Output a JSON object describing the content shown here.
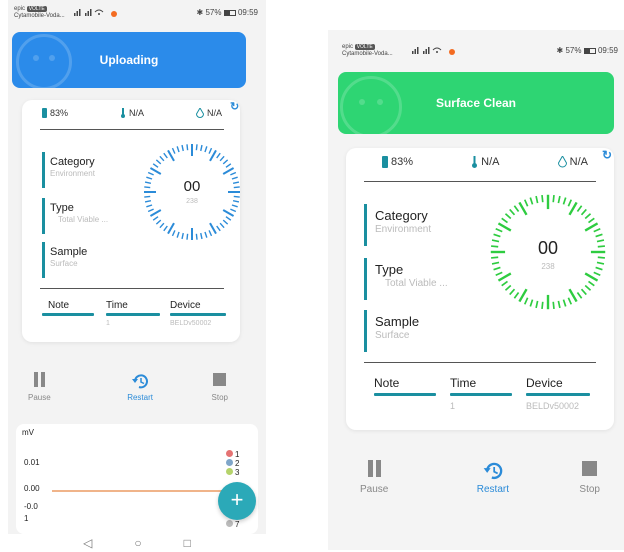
{
  "statusbar": {
    "carrier_tag": "epic",
    "carrier_badge": "VOLTE",
    "carrier_name": "Cytamobile-Voda...",
    "signal_icons": "signal-icon",
    "bluetooth": "✱",
    "battery_pct": "57%",
    "time": "09:59"
  },
  "left": {
    "banner_title": "Uploading",
    "banner_color": "#2b8bea",
    "stats": {
      "battery": "83%",
      "temp": "N/A",
      "humidity": "N/A"
    },
    "fields": [
      {
        "label": "Category",
        "value": "Environment"
      },
      {
        "label": "Type",
        "value": "Total Viable ..."
      },
      {
        "label": "Sample",
        "value": "Surface"
      }
    ],
    "gauge": {
      "main": "00",
      "sub": "238"
    },
    "columns": [
      {
        "header": "Note",
        "value": ""
      },
      {
        "header": "Time",
        "value": "1"
      },
      {
        "header": "Device",
        "value": "BELDv50002"
      }
    ],
    "controls": {
      "pause": "Pause",
      "restart": "Restart",
      "stop": "Stop"
    },
    "chart": {
      "ylabel": "mV",
      "ticks": [
        "0.01",
        "0.00",
        "-0.0",
        "1"
      ],
      "legend": [
        "1",
        "2",
        "3",
        "7"
      ],
      "fab": "+"
    }
  },
  "right": {
    "banner_title": "Surface Clean",
    "banner_color": "#2ed573",
    "stats": {
      "battery": "83%",
      "temp": "N/A",
      "humidity": "N/A"
    },
    "fields": [
      {
        "label": "Category",
        "value": "Environment"
      },
      {
        "label": "Type",
        "value": "Total Viable ..."
      },
      {
        "label": "Sample",
        "value": "Surface"
      }
    ],
    "gauge": {
      "main": "00",
      "sub": "238"
    },
    "columns": [
      {
        "header": "Note",
        "value": ""
      },
      {
        "header": "Time",
        "value": "1"
      },
      {
        "header": "Device",
        "value": "BELDv50002"
      }
    ],
    "controls": {
      "pause": "Pause",
      "restart": "Restart",
      "stop": "Stop"
    }
  },
  "navbar": {
    "back": "◁",
    "home": "○",
    "recent": "□"
  },
  "colors": {
    "accent_teal": "#1a8fa0",
    "active_blue": "#2b8bd8",
    "gauge_blue": "#2b8bd8",
    "gauge_green": "#2ecc40"
  }
}
